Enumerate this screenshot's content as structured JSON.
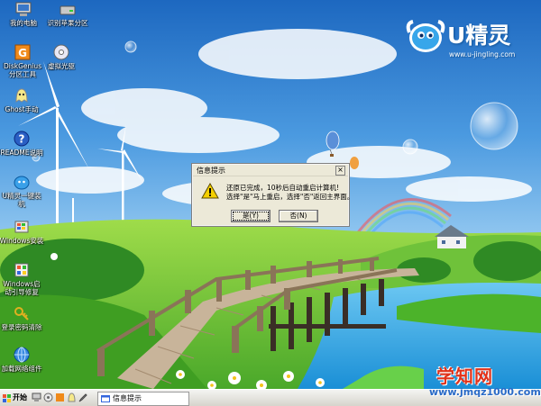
{
  "desktop_icons": [
    {
      "id": "my-computer",
      "label": "我的电脑"
    },
    {
      "id": "recognize-partition",
      "label": "识别苹果分区"
    },
    {
      "id": "diskgenius",
      "label": "DiskGenius分区工具"
    },
    {
      "id": "virtual-drive",
      "label": "虚拟光驱"
    },
    {
      "id": "ghost",
      "label": "Ghost手动"
    },
    {
      "id": "readme",
      "label": "README说明"
    },
    {
      "id": "ujingling-install",
      "label": "U精灵一键装机"
    },
    {
      "id": "windows-install",
      "label": "Windows安装"
    },
    {
      "id": "windows-boot-repair",
      "label": "Windows启动引导修复"
    },
    {
      "id": "password-clear",
      "label": "登录密码清除"
    },
    {
      "id": "network-component",
      "label": "加载网络组件"
    }
  ],
  "logo": {
    "brand": "U精灵",
    "url": "www.u-jingling.com"
  },
  "dialog": {
    "title": "信息提示",
    "close": "×",
    "message_line1": "还原已完成，10秒后自动重启计算机!",
    "message_line2": "选择\"是\"马上重启，选择\"否\"返回主界面。",
    "yes_label": "是(Y)",
    "no_label": "否(N)"
  },
  "taskbar": {
    "start_label": "开始",
    "task_label": "信息提示"
  },
  "watermark": {
    "line1": "学知网",
    "line2": "www.jmqz1000.com"
  },
  "colors": {
    "sky_top": "#1f6fc4",
    "grass": "#5cbf2a",
    "water": "#2a9fe0",
    "dialog_bg": "#ece9d8"
  }
}
